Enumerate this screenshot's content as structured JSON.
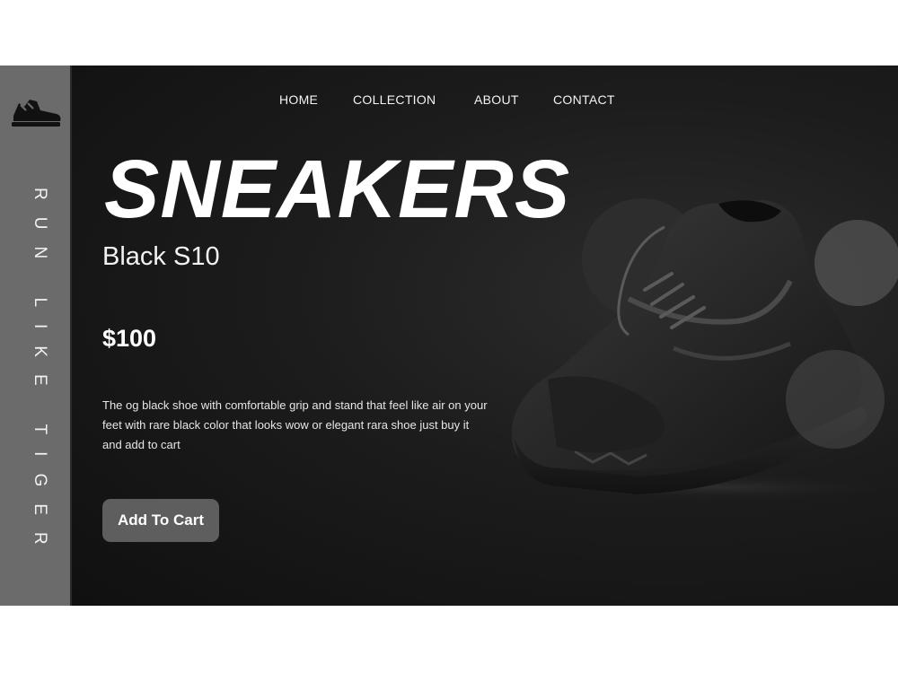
{
  "brand": {
    "logo_icon": "sneaker-icon",
    "tagline": "RUN LIKE TIGER"
  },
  "nav": {
    "items": [
      {
        "label": "HOME"
      },
      {
        "label": "COLLECTION"
      },
      {
        "label": "ABOUT"
      },
      {
        "label": "CONTACT"
      }
    ]
  },
  "hero": {
    "headline": "SNEAKERS",
    "model": "Black S10",
    "price": "$100",
    "description": "The og black shoe with comfortable grip and stand that feel like air on your feet with rare black color that looks wow or elegant rara shoe just buy it and add to cart",
    "cta_label": "Add To Cart",
    "product_image": "black-sneaker-image"
  },
  "colors": {
    "background": "#141414",
    "sidebar": "#6b6b6b",
    "button": "#5e5e5e",
    "text": "#ffffff"
  }
}
